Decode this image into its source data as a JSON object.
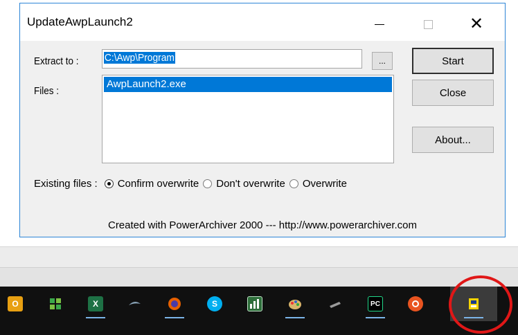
{
  "window": {
    "title": "UpdateAwpLaunch2",
    "minimize": "—",
    "close": "✕"
  },
  "form": {
    "extract_label": "Extract to :",
    "extract_value": "C:\\Awp\\Program",
    "browse_label": "...",
    "files_label": "Files :",
    "files": [
      "AwpLaunch2.exe"
    ],
    "existing_label": "Existing files :",
    "options": [
      "Confirm overwrite",
      "Don't overwrite",
      "Overwrite"
    ],
    "selected_option": "Confirm overwrite"
  },
  "buttons": {
    "start": "Start",
    "close": "Close",
    "about": "About..."
  },
  "footer": "Created with PowerArchiver 2000 --- http://www.powerarchiver.com",
  "taskbar": {
    "icons": [
      "outlook-icon",
      "games-icon",
      "excel-icon",
      "app-arrow-icon",
      "firefox-icon",
      "skype-icon",
      "chart-app-icon",
      "paint-icon",
      "pen-icon",
      "pycharm-icon",
      "ubuntu-icon",
      "updater-icon"
    ]
  }
}
